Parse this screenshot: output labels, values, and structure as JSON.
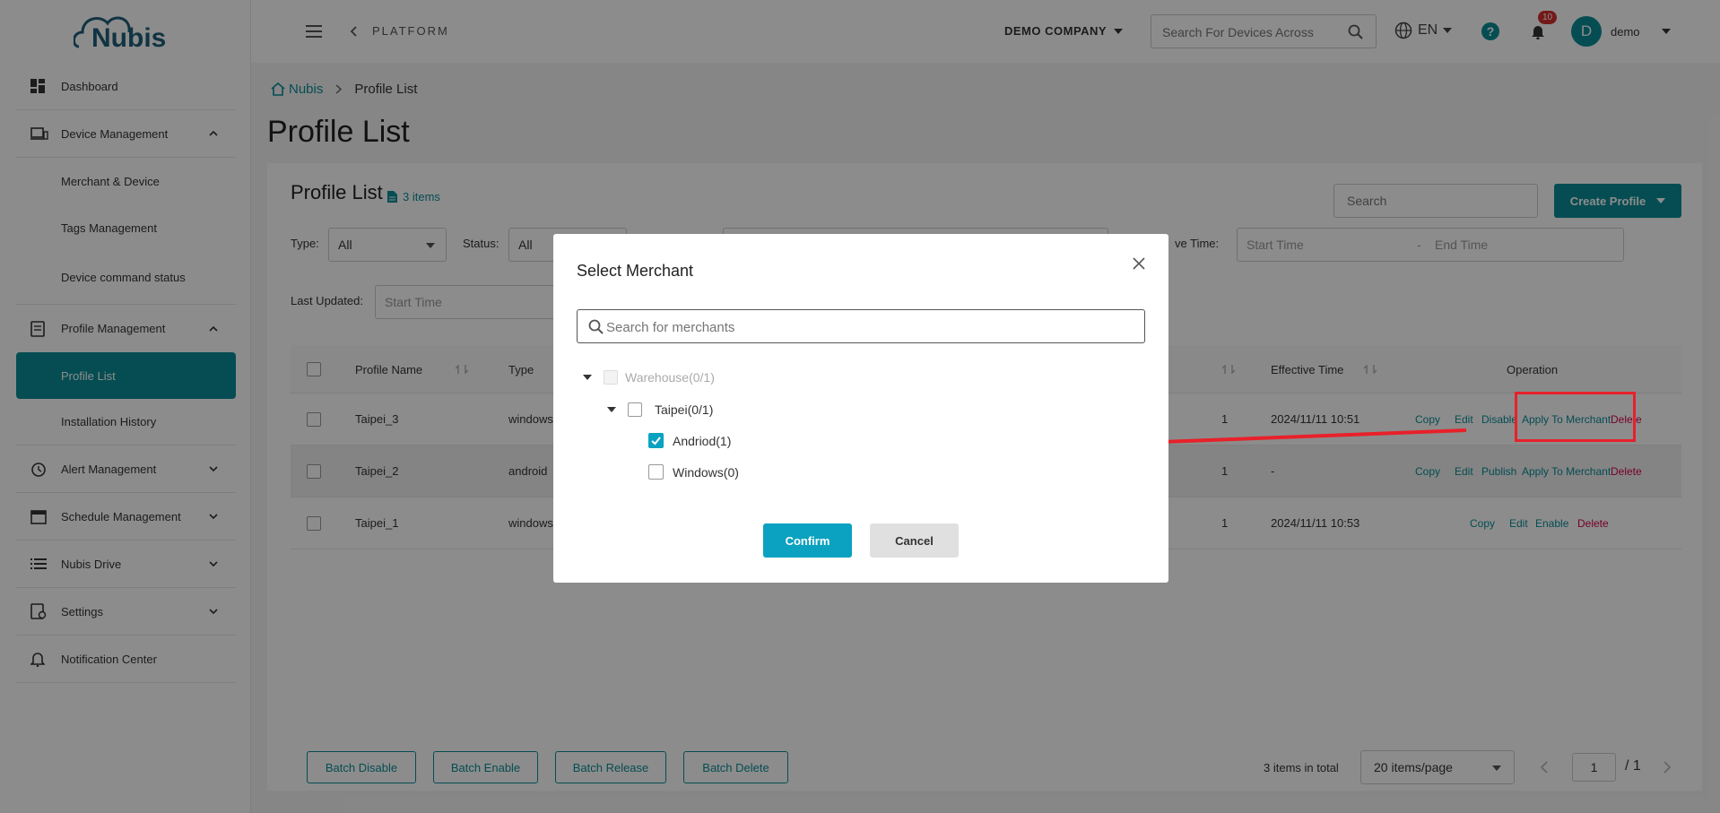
{
  "brand": {
    "name": "Nubis"
  },
  "sidebar": {
    "items": [
      {
        "label": "Dashboard"
      },
      {
        "label": "Device Management"
      },
      {
        "label": "Merchant & Device"
      },
      {
        "label": "Tags Management"
      },
      {
        "label": "Device command status"
      },
      {
        "label": "Profile Management"
      },
      {
        "label": "Profile List"
      },
      {
        "label": "Installation History"
      },
      {
        "label": "Alert Management"
      },
      {
        "label": "Schedule Management"
      },
      {
        "label": "Nubis Drive"
      },
      {
        "label": "Settings"
      },
      {
        "label": "Notification Center"
      }
    ]
  },
  "topbar": {
    "back_label": "PLATFORM",
    "company": "DEMO COMPANY",
    "search_placeholder": "Search For Devices Across",
    "language": "EN",
    "notification_count": "10",
    "avatar_letter": "D",
    "username": "demo"
  },
  "breadcrumb": {
    "home": "Nubis",
    "current": "Profile List"
  },
  "page": {
    "title": "Profile List"
  },
  "card": {
    "title": "Profile List",
    "item_count": "3 items",
    "search_placeholder": "Search",
    "create_button": "Create Profile",
    "filters": {
      "type_label": "Type:",
      "type_value": "All",
      "status_label": "Status:",
      "status_value": "All",
      "effective_label": "ve Time:",
      "start_placeholder": "Start Time",
      "separator": "-",
      "end_placeholder": "End Time",
      "last_updated_label": "Last Updated:",
      "last_updated_start": "Start Time"
    },
    "columns": {
      "name": "Profile Name",
      "type": "Type",
      "effective": "Effective Time",
      "operation": "Operation"
    },
    "rows": [
      {
        "name": "Taipei_3",
        "type": "windows",
        "frag": "1",
        "effective": "2024/11/11 10:51",
        "ops": [
          "Copy",
          "Edit",
          "Disable",
          "Apply To Merchant",
          "Delete"
        ]
      },
      {
        "name": "Taipei_2",
        "type": "android",
        "frag": "1",
        "effective": "-",
        "ops": [
          "Copy",
          "Edit",
          "Publish",
          "Apply To Merchant",
          "Delete"
        ]
      },
      {
        "name": "Taipei_1",
        "type": "windows",
        "frag": "1",
        "effective": "2024/11/11 10:53",
        "ops": [
          "Copy",
          "Edit",
          "Enable",
          "Delete"
        ]
      }
    ],
    "batch": [
      "Batch Disable",
      "Batch Enable",
      "Batch Release",
      "Batch Delete"
    ],
    "pagination": {
      "total": "3 items in total",
      "page_size": "20 items/page",
      "current": "1",
      "of": "/ 1"
    }
  },
  "modal": {
    "title": "Select Merchant",
    "search_placeholder": "Search for merchants",
    "tree": [
      {
        "label": "Warehouse(0/1)"
      },
      {
        "label": "Taipei(0/1)"
      },
      {
        "label": "Andriod(1)",
        "checked": true
      },
      {
        "label": "Windows(0)"
      }
    ],
    "confirm": "Confirm",
    "cancel": "Cancel"
  },
  "colors": {
    "accent": "#0a8c97",
    "danger": "#d6004e",
    "annotation": "#e8202a"
  }
}
